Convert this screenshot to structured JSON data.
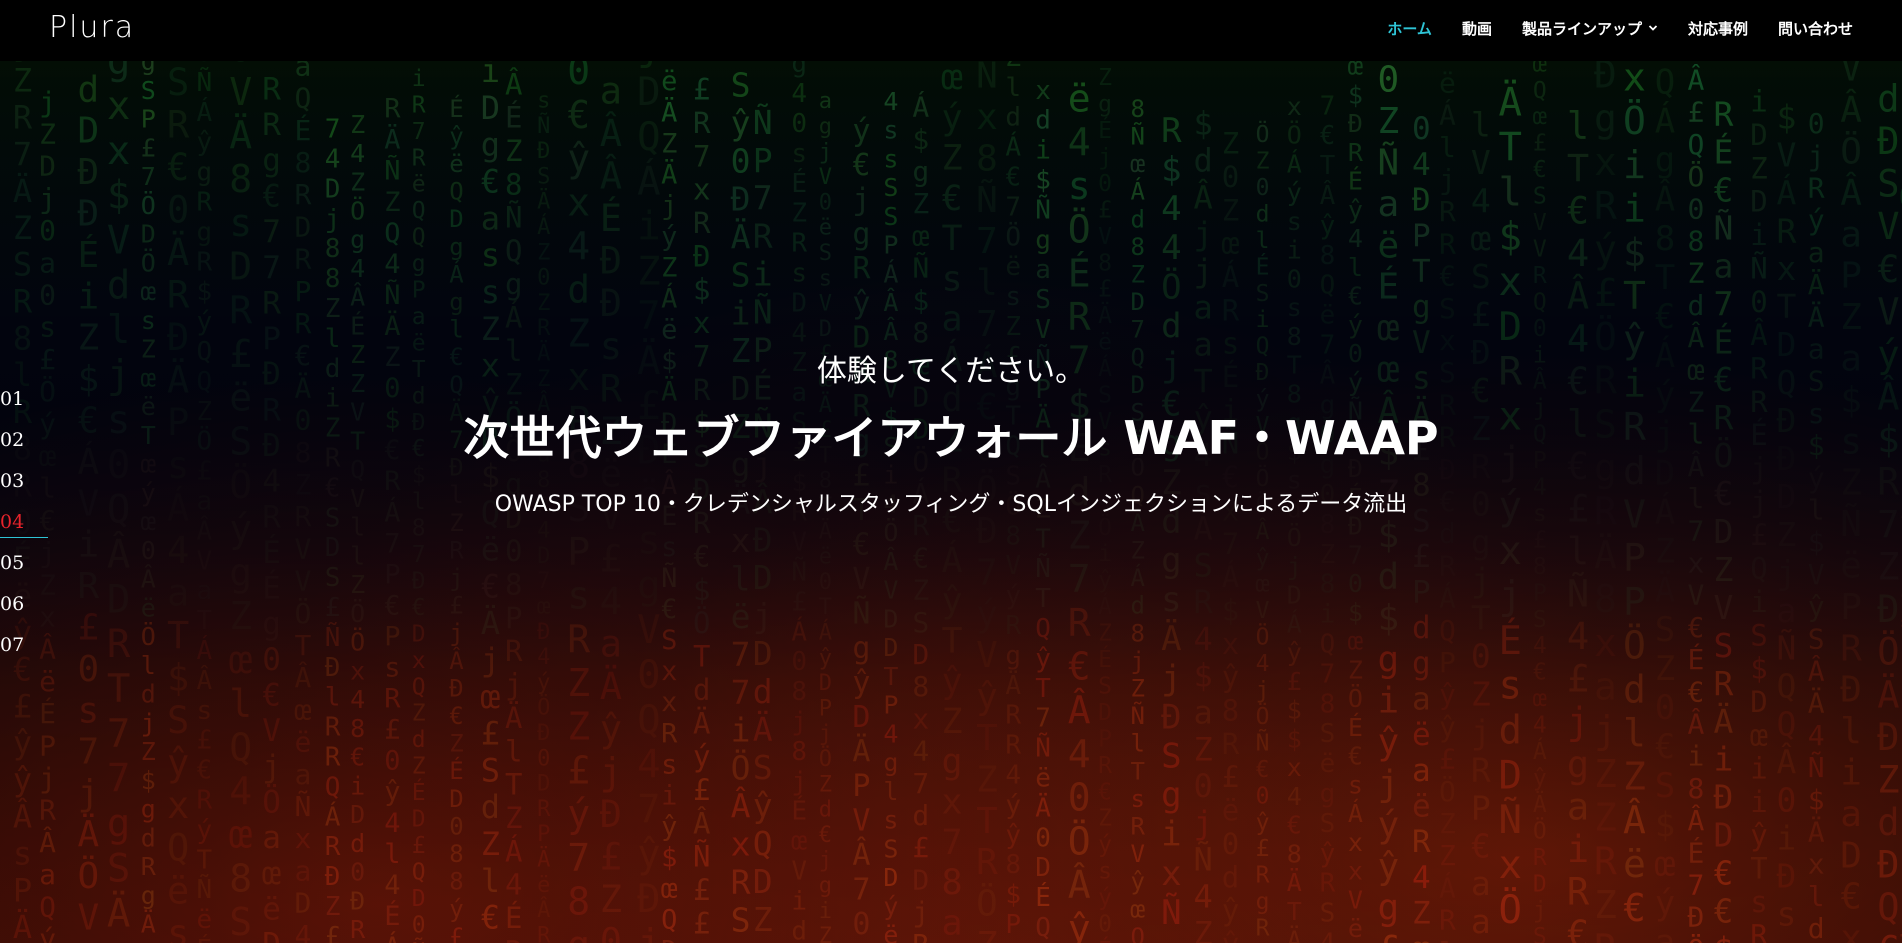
{
  "header": {
    "logo": "Plura",
    "nav": [
      {
        "label": "ホーム",
        "active": true
      },
      {
        "label": "動画",
        "active": false
      },
      {
        "label": "製品ラインアップ",
        "active": false,
        "has_dropdown": true
      },
      {
        "label": "対応事例",
        "active": false
      },
      {
        "label": "問い合わせ",
        "active": false
      }
    ],
    "active_color": "#2ec4d6"
  },
  "hero": {
    "subtitle": "体験してください。",
    "title": "次世代ウェブファイアウォール WAF・WAAP",
    "description": "OWASP TOP 10・クレデンシャルスタッフィング・SQLインジェクションによるデータ流出"
  },
  "slides": {
    "items": [
      "01",
      "02",
      "03",
      "04",
      "05",
      "06",
      "07"
    ],
    "active_index": 3,
    "active_color": "#e8232b"
  },
  "background": {
    "glyphs": [
      "4",
      "0",
      "Ñ",
      "Ö",
      "£",
      "D",
      "Z",
      "T",
      "R",
      "€",
      "S",
      "Á",
      "s",
      "d",
      "ý",
      "ë",
      "œ",
      "7",
      "Đ",
      "Â",
      "$",
      "x",
      "g",
      "É",
      "P",
      "R",
      "V",
      "8",
      "Z",
      "a",
      "ŷ",
      "j",
      "i",
      "l",
      "Ä",
      "Q"
    ]
  }
}
